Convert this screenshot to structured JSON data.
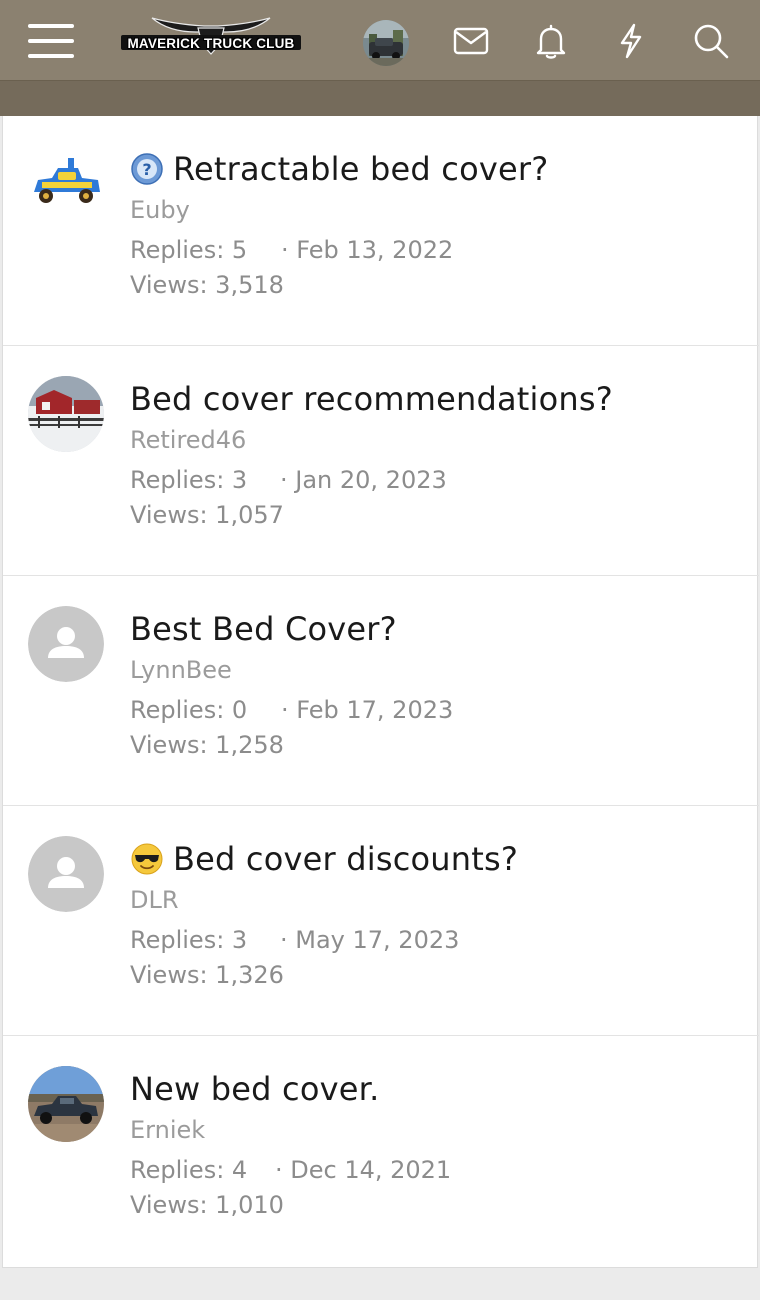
{
  "header": {
    "logo_text": "MAVERICK TRUCK CLUB",
    "icons": [
      "menu-icon",
      "mail-icon",
      "bell-icon",
      "bolt-icon",
      "search-icon"
    ]
  },
  "colors": {
    "header_bg": "#8b8170",
    "subbar_bg": "#756b5b",
    "meta_text": "#8c8c8c",
    "title_text": "#1a1a1a"
  },
  "threads": [
    {
      "title": "Retractable bed cover?",
      "prefix_icon": "question-icon",
      "author": "Euby",
      "replies": "Replies: 5",
      "date": "· Feb 13, 2022",
      "views": "Views: 3,518",
      "avatar": "cartoon-truck-avatar"
    },
    {
      "title": "Bed cover recommendations?",
      "prefix_icon": "",
      "author": "Retired46",
      "replies": "Replies: 3",
      "date": "· Jan 20, 2023",
      "views": "Views: 1,057",
      "avatar": "barn-photo-avatar"
    },
    {
      "title": "Best Bed Cover?",
      "prefix_icon": "",
      "author": "LynnBee",
      "replies": "Replies: 0",
      "date": "· Feb 17, 2023",
      "views": "Views: 1,258",
      "avatar": "default-user-avatar"
    },
    {
      "title": "Bed cover discounts?",
      "prefix_icon": "cool-emoji-icon",
      "author": "DLR",
      "replies": "Replies: 3",
      "date": "· May 17, 2023",
      "views": "Views: 1,326",
      "avatar": "default-user-avatar"
    },
    {
      "title": "New bed cover.",
      "prefix_icon": "",
      "author": "Erniek",
      "replies": "Replies: 4",
      "date": "· Dec 14, 2021",
      "views": "Views: 1,010",
      "avatar": "truck-photo-avatar"
    }
  ]
}
